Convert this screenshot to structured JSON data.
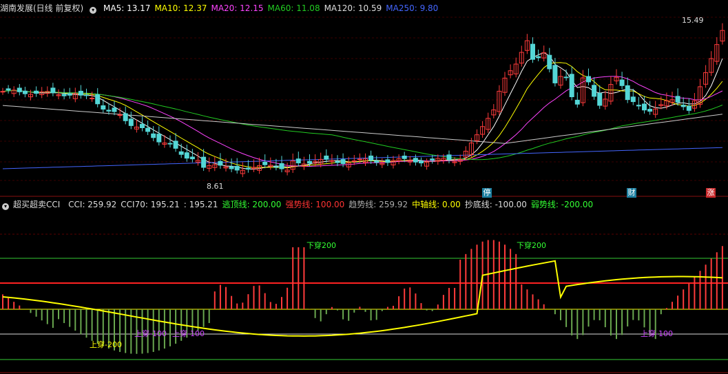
{
  "top_legend": {
    "title": "湖南发展(日线 前复权)",
    "ma": [
      {
        "label": "MA5: 13.17",
        "color": "#ffffff"
      },
      {
        "label": "MA10: 12.37",
        "color": "#ffff00"
      },
      {
        "label": "MA20: 12.15",
        "color": "#ff44ff"
      },
      {
        "label": "MA60: 11.08",
        "color": "#22cc22"
      },
      {
        "label": "MA120: 10.59",
        "color": "#dddddd"
      },
      {
        "label": "MA250: 9.80",
        "color": "#4466ff"
      }
    ]
  },
  "price_labels": {
    "high": "15.49",
    "low": "8.61"
  },
  "badges": [
    {
      "text": "停",
      "color": "#1e7fa0"
    },
    {
      "text": "财",
      "color": "#1e7fa0"
    },
    {
      "text": "涨",
      "color": "#c8292b"
    }
  ],
  "bottom_legend": {
    "title": "超买超卖CCI",
    "items": [
      {
        "label": "CCI: 259.92",
        "color": "#dddddd"
      },
      {
        "label": "CCI70: 195.21",
        "color": "#dddddd"
      },
      {
        "label": ": 195.21",
        "color": "#dddddd"
      },
      {
        "label": "逃顶线: 200.00",
        "color": "#33ff33"
      },
      {
        "label": "强势线: 100.00",
        "color": "#ff3333"
      },
      {
        "label": "趋势线: 259.92",
        "color": "#aaaaaa"
      },
      {
        "label": "中轴线: 0.00",
        "color": "#ffff00"
      },
      {
        "label": "抄底线: -100.00",
        "color": "#dddddd"
      },
      {
        "label": "弱势线: -200.00",
        "color": "#33ff33"
      }
    ]
  },
  "annotations": [
    "下穿200",
    "下穿200",
    "上穿-200",
    "上穿-100",
    "上穿-100",
    "上穿-100"
  ],
  "colors": {
    "up": "#ff3b3b",
    "down": "#54d6d6",
    "background": "#000000"
  }
}
